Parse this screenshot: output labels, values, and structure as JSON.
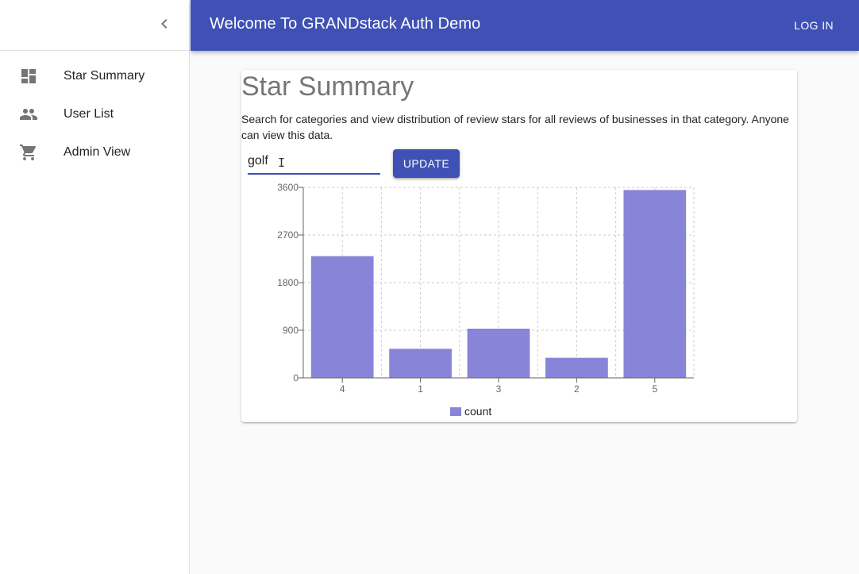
{
  "appbar": {
    "title": "Welcome To GRANDstack Auth Demo",
    "login_label": "LOG IN",
    "color": "#3f51b5"
  },
  "sidebar": {
    "collapse_icon": "chevron-left-icon",
    "items": [
      {
        "label": "Star Summary",
        "icon": "dashboard-icon"
      },
      {
        "label": "User List",
        "icon": "people-icon"
      },
      {
        "label": "Admin View",
        "icon": "shopping-cart-icon"
      }
    ]
  },
  "main": {
    "title": "Star Summary",
    "description": "Search for categories and view distribution of review stars for all reviews of businesses in that category. Anyone can view this data.",
    "search": {
      "value": "golf",
      "placeholder": ""
    },
    "update_label": "UPDATE"
  },
  "chart_data": {
    "type": "bar",
    "categories": [
      "4",
      "1",
      "3",
      "2",
      "5"
    ],
    "series": [
      {
        "name": "count",
        "values": [
          2300,
          550,
          930,
          380,
          3550
        ],
        "color": "#8884d8"
      }
    ],
    "yticks": [
      0,
      900,
      1800,
      2700,
      3600
    ],
    "ylim": [
      0,
      3600
    ],
    "grid": true,
    "legend_position": "bottom"
  }
}
